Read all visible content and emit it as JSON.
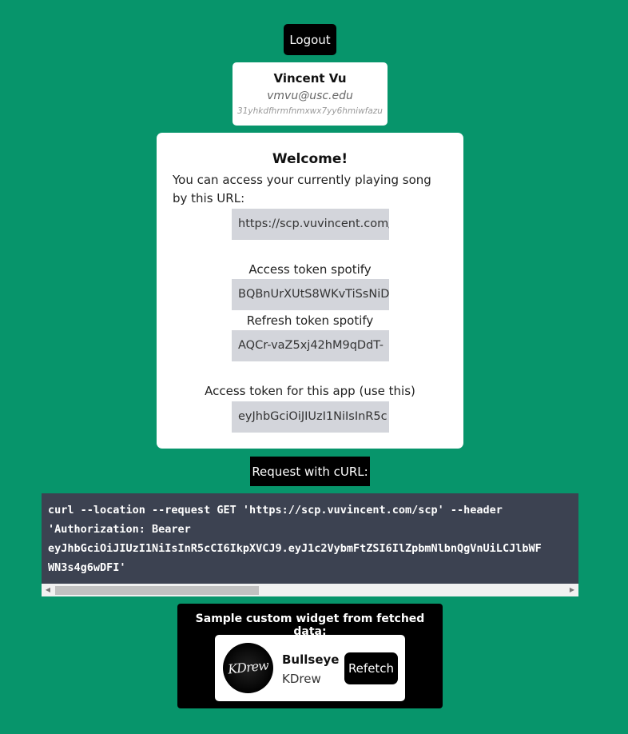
{
  "header": {
    "logout_label": "Logout"
  },
  "user": {
    "name": "Vincent Vu",
    "email": "vmvu@usc.edu",
    "id": "31yhkdfhrmfnmxwx7yy6hmiwfazu"
  },
  "welcome": {
    "title": "Welcome!",
    "description": "You can access your currently playing song by this URL:",
    "url_value": "https://scp.vuvincent.com/scp",
    "spotify_access_label": "Access token spotify",
    "spotify_access_value": "BQBnUrXUtS8WKvTiSsNiD",
    "spotify_refresh_label": "Refresh token spotify",
    "spotify_refresh_value": "AQCr-vaZ5xj42hM9qDdT-",
    "app_token_label": "Access token for this app (use this)",
    "app_token_value": "eyJhbGciOiJIUzI1NiIsInR5c"
  },
  "curl": {
    "button_label": "Request with cURL:",
    "code": "curl --location --request GET 'https://scp.vuvincent.com/scp' --header\n'Authorization: Bearer\neyJhbGciOiJIUzI1NiIsInR5cCI6IkpXVCJ9.eyJ1c2VybmFtZSI6IlZpbmNlbnQgVnUiLCJlbWF\nWN3s4g6wDFI'"
  },
  "widget": {
    "title": "Sample custom widget from fetched data:",
    "song_title": "Bullseye",
    "artist": "KDrew",
    "album_logo_text": "KDrew",
    "refetch_label": "Refetch"
  }
}
